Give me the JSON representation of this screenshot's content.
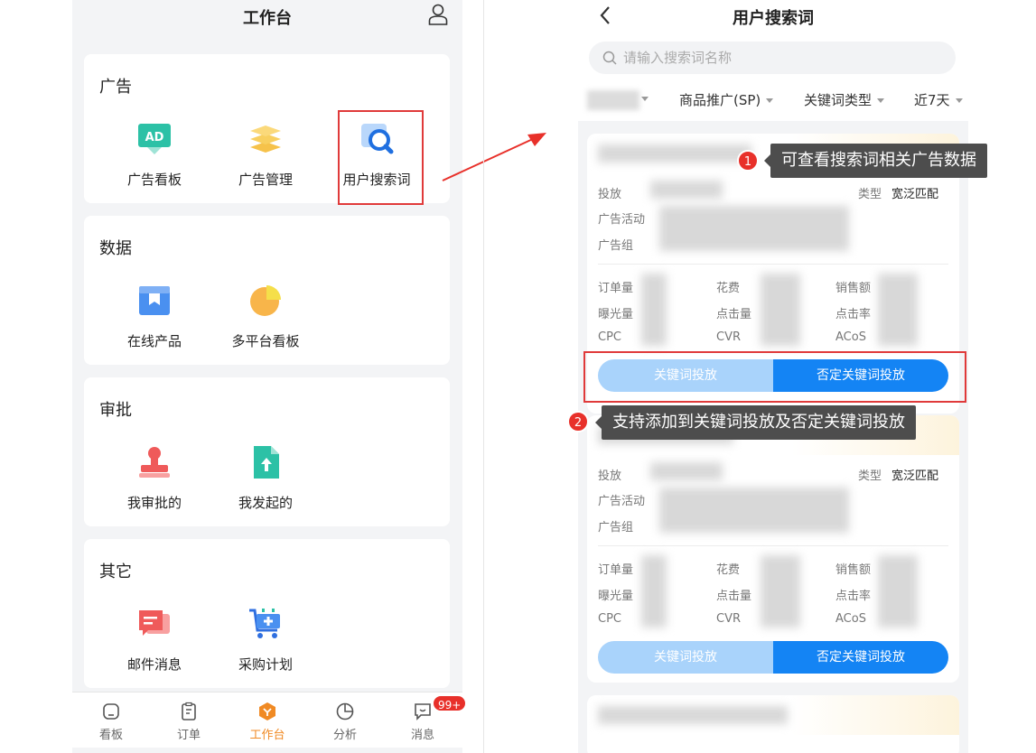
{
  "left": {
    "title": "工作台",
    "sections": [
      {
        "title": "广告",
        "tiles": [
          "广告看板",
          "广告管理",
          "用户搜索词"
        ]
      },
      {
        "title": "数据",
        "tiles": [
          "在线产品",
          "多平台看板"
        ]
      },
      {
        "title": "审批",
        "tiles": [
          "我审批的",
          "我发起的"
        ]
      },
      {
        "title": "其它",
        "tiles": [
          "邮件消息",
          "采购计划"
        ]
      }
    ],
    "ad_icon_text": "AD",
    "tabbar": [
      {
        "label": "看板",
        "icon": "dashboard-icon"
      },
      {
        "label": "订单",
        "icon": "clipboard-icon"
      },
      {
        "label": "工作台",
        "icon": "workbench-icon"
      },
      {
        "label": "分析",
        "icon": "pie-chart-icon"
      },
      {
        "label": "消息",
        "icon": "message-icon"
      }
    ],
    "badge": "99+"
  },
  "right": {
    "title": "用户搜索词",
    "search_placeholder": "请输入搜索词名称",
    "filters": [
      "商品推广(SP)",
      "关键词类型",
      "近7天"
    ],
    "card_labels": {
      "target": "投放",
      "campaign": "广告活动",
      "ad_group": "广告组",
      "type_label": "类型",
      "type_value": "宽泛匹配",
      "orders": "订单量",
      "spend": "花费",
      "sales": "销售额",
      "impressions": "曝光量",
      "clicks": "点击量",
      "ctr": "点击率",
      "cpc": "CPC",
      "cvr": "CVR",
      "acos": "ACoS"
    },
    "buttons": {
      "keyword": "关键词投放",
      "negative": "否定关键词投放"
    }
  },
  "annotations": [
    {
      "number": "1",
      "text": "可查看搜索词相关广告数据"
    },
    {
      "number": "2",
      "text": "支持添加到关键词投放及否定关键词投放"
    }
  ],
  "colors": {
    "accent": "#1484f4",
    "highlight": "#e03a3a",
    "active_tab": "#f08a24"
  }
}
